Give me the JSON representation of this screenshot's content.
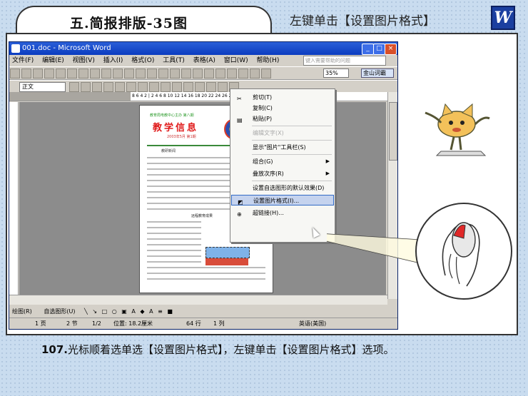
{
  "header": {
    "tab_title": "五.简报排版-35图",
    "caption": "左键单击【设置图片格式】",
    "logo_letter": "W"
  },
  "window": {
    "title": "001.doc - Microsoft Word",
    "menu": [
      "文件(F)",
      "编辑(E)",
      "视图(V)",
      "插入(I)",
      "格式(O)",
      "工具(T)",
      "表格(A)",
      "窗口(W)",
      "帮助(H)"
    ],
    "help_placeholder": "键入需要帮助的问题",
    "style_value": "正文",
    "zoom_value": "35%",
    "ime_label": "金山词霸",
    "ruler_text": "8 6 4 2 | 2 4 6 8 10 12 14 16 18 20 22 24 26 28 30 32",
    "drawbar_label": "绘图(R)",
    "autoshape_label": "自选图形(U)",
    "status": {
      "page": "1 页",
      "section": "2 节",
      "page_of": "1/2",
      "position": "位置: 18.2厘米",
      "line": "64 行",
      "column": "1 列",
      "language": "英语(美国)"
    }
  },
  "page": {
    "small_line": "教育局电教中心主办 第八期",
    "title": "教学信息",
    "subtitle": "2003年5月 第1期",
    "heading": "教研新闻",
    "section": "远程教育成果"
  },
  "context_menu": {
    "items": [
      {
        "label": "剪切(T)",
        "state": "normal"
      },
      {
        "label": "复制(C)",
        "state": "normal"
      },
      {
        "label": "粘贴(P)",
        "state": "normal"
      },
      {
        "label": "编辑文字(X)",
        "state": "disabled"
      },
      {
        "label": "显示\"图片\"工具栏(S)",
        "state": "normal"
      },
      {
        "label": "组合(G)",
        "state": "submenu"
      },
      {
        "label": "叠放次序(R)",
        "state": "submenu"
      },
      {
        "label": "设置自选图形的默认效果(D)",
        "state": "normal"
      },
      {
        "label": "设置图片格式(I)...",
        "state": "highlighted"
      },
      {
        "label": "超链接(H)...",
        "state": "normal"
      }
    ]
  },
  "caption": {
    "number": "107.",
    "text": "光标顺着选单选【设置图片格式】，左键单击【设置图片格式】选项。"
  },
  "colors": {
    "background": "#c9dcef",
    "titlebar": "#0b3cc0",
    "menu_highlight": "#c5d3ee",
    "page_title": "#e01a1a"
  }
}
